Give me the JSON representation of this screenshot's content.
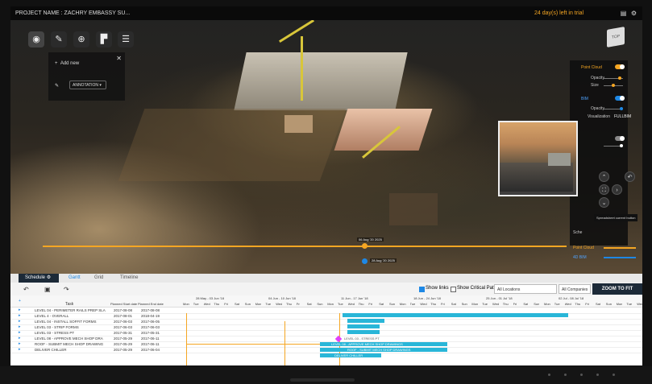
{
  "header": {
    "project_name": "PROJECT NAME : ZACHRY EMBASSY SU...",
    "trial_text": "24 day(s) left in trial"
  },
  "viewer": {
    "add_new_label": "Add new",
    "annotation_label": "ANNOTATION",
    "layers": {
      "point_cloud": "Point Cloud",
      "opacity": "Opacity",
      "size": "Size",
      "bim": "BIM",
      "opacity2": "Opacity",
      "visualization": "Visualization",
      "visualization_value": "FULLBIM",
      "schedule_short": "Sche"
    },
    "tooltip": "Spreadsheet current button",
    "timeline_date": "06 Aug '20 2025",
    "timeline_date2": "28 Aug '20 2025",
    "legend": {
      "point_cloud": "Point Cloud",
      "bim": "4D BIM"
    },
    "colors": {
      "accent": "#f5a623",
      "bim": "#1e88e5",
      "bar": "#29b6d8"
    }
  },
  "schedule": {
    "tabs": [
      "Schedule",
      "Gantt",
      "Grid",
      "Timeline"
    ],
    "show_links": "Show links",
    "show_critical_path": "Show Critical Path",
    "locations": "All Locations",
    "companies": "All Companies",
    "companies_count": "3",
    "zoom_to_fit": "ZOOM TO FIT",
    "columns": [
      "Task",
      "Planned Start date",
      "Planned End date"
    ],
    "weeks": [
      "28 May - 03 Jun '18",
      "04 Jun - 10 Jun '18",
      "11 Jun - 17 Jun '18",
      "18 Jun - 24 Jun '18",
      "25 Jun - 01 Jul '18",
      "02 Jul - 08 Jul '18"
    ],
    "days": [
      "Mon",
      "Tue",
      "Wed",
      "Thu",
      "Fri",
      "Sat",
      "Sun",
      "Mon",
      "Tue",
      "Wed",
      "Thu",
      "Fri",
      "Sat",
      "Sun",
      "Mon",
      "Tue",
      "Wed",
      "Thu",
      "Fri",
      "Sat",
      "Sun",
      "Mon",
      "Tue",
      "Wed",
      "Thu",
      "Fri",
      "Sat",
      "Sun",
      "Mon",
      "Tue",
      "Wed",
      "Thu",
      "Fri",
      "Sat",
      "Sun",
      "Mon",
      "Tue",
      "Wed",
      "Thu",
      "Fri",
      "Sat",
      "Sun",
      "Mon",
      "Tue",
      "Wed",
      "Thu",
      "Fri"
    ],
    "rows": [
      {
        "task": "LEVEL 04 - PERIMETER RAILS PREP SLA",
        "start": "2017-08-08",
        "end": "2017-08-08"
      },
      {
        "task": "LEVEL 4 - OVERALL",
        "start": "2017-08-01",
        "end": "2018-04-19"
      },
      {
        "task": "LEVEL 04 - INSTALL SOFFIT FORMS",
        "start": "2017-06-03",
        "end": "2017-06-05"
      },
      {
        "task": "LEVEL 03 - STRIP FORMS",
        "start": "2017-06-03",
        "end": "2017-06-03"
      },
      {
        "task": "LEVEL 03 - STRESS PT",
        "start": "2017-05-31",
        "end": "2017-05-31"
      },
      {
        "task": "LEVEL 08 - APPROVE MECH SHOP DRA",
        "start": "2017-05-29",
        "end": "2017-06-11"
      },
      {
        "task": "ROOF - SUBMIT MECH SHOP DRAWING",
        "start": "2017-05-29",
        "end": "2017-06-11"
      },
      {
        "task": "DELIVER CHILLER",
        "start": "2017-05-29",
        "end": "2017-06-04"
      }
    ],
    "bar_labels": {
      "stress": "LEVEL 03 - STRESS PT",
      "approve": "LEVEL 08 - APPROVE MECH SHOP DRAWINGS",
      "roof": "ROOF - SUBMIT MECH SHOP DRAWINGS",
      "chiller": "DELIVER CHILLER"
    }
  }
}
